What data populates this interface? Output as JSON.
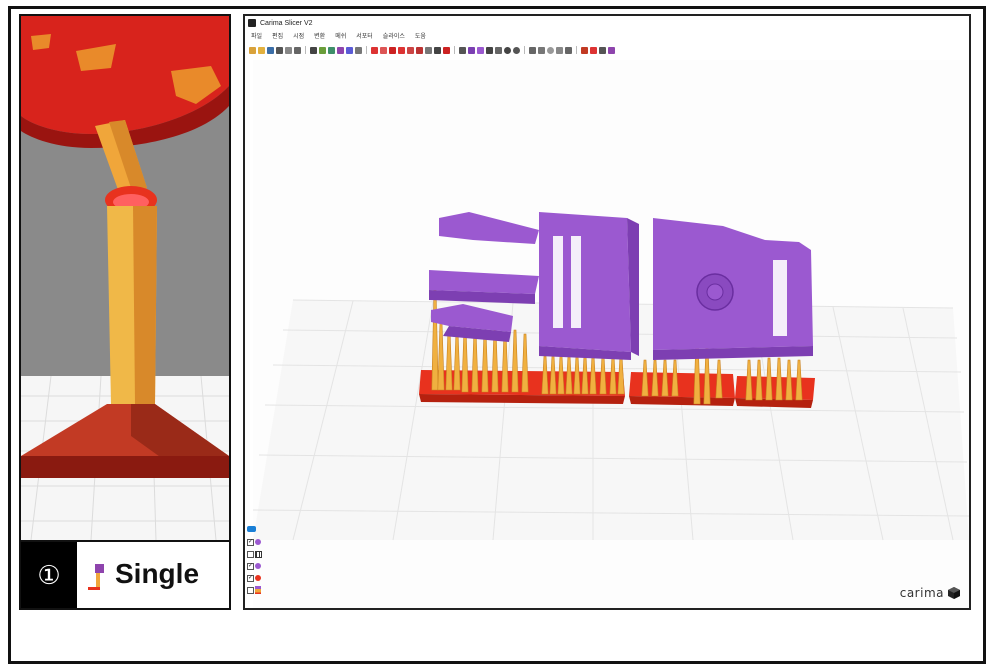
{
  "caption": {
    "number": "①",
    "label": "Single"
  },
  "app": {
    "title": "Carima Slicer V2",
    "menu": [
      "파일",
      "편집",
      "시점",
      "변환",
      "메쉬",
      "서포터",
      "슬라이스",
      "도움"
    ],
    "brand": "carima"
  },
  "colors": {
    "model": "#9b59d0",
    "support": "#f2b23c",
    "base": "#e8321e",
    "accent_blue": "#1a7fd6"
  },
  "toolbar_icons": [
    "new-file-icon",
    "open-file-icon",
    "save-icon",
    "print-icon",
    "undo-icon",
    "redo-icon",
    "view-front-icon",
    "view-top-icon",
    "view-side-icon",
    "view-iso-icon",
    "view-bottom-icon",
    "view-persp-icon",
    "support-point-icon",
    "support-line-icon",
    "support-tree-icon",
    "move-icon",
    "rotate-icon",
    "scale-icon",
    "mirror-icon",
    "center-icon",
    "layout-icon",
    "cut-icon",
    "hollow-icon",
    "drain-icon",
    "grid-icon",
    "measure-icon",
    "circle-icon",
    "sphere-icon",
    "cone-icon",
    "cylinder-icon",
    "ring-icon",
    "arrow-icon",
    "ruler-icon",
    "single-support-icon",
    "support-settings-icon",
    "slice-icon",
    "export-icon"
  ],
  "side_list": [
    {
      "checked": true,
      "icon": "purple-dot-icon"
    },
    {
      "checked": false,
      "icon": "grid-icon"
    },
    {
      "checked": true,
      "icon": "purple-dot-icon"
    },
    {
      "checked": true,
      "icon": "red-dot-icon"
    },
    {
      "checked": false,
      "icon": "support-icon"
    }
  ]
}
